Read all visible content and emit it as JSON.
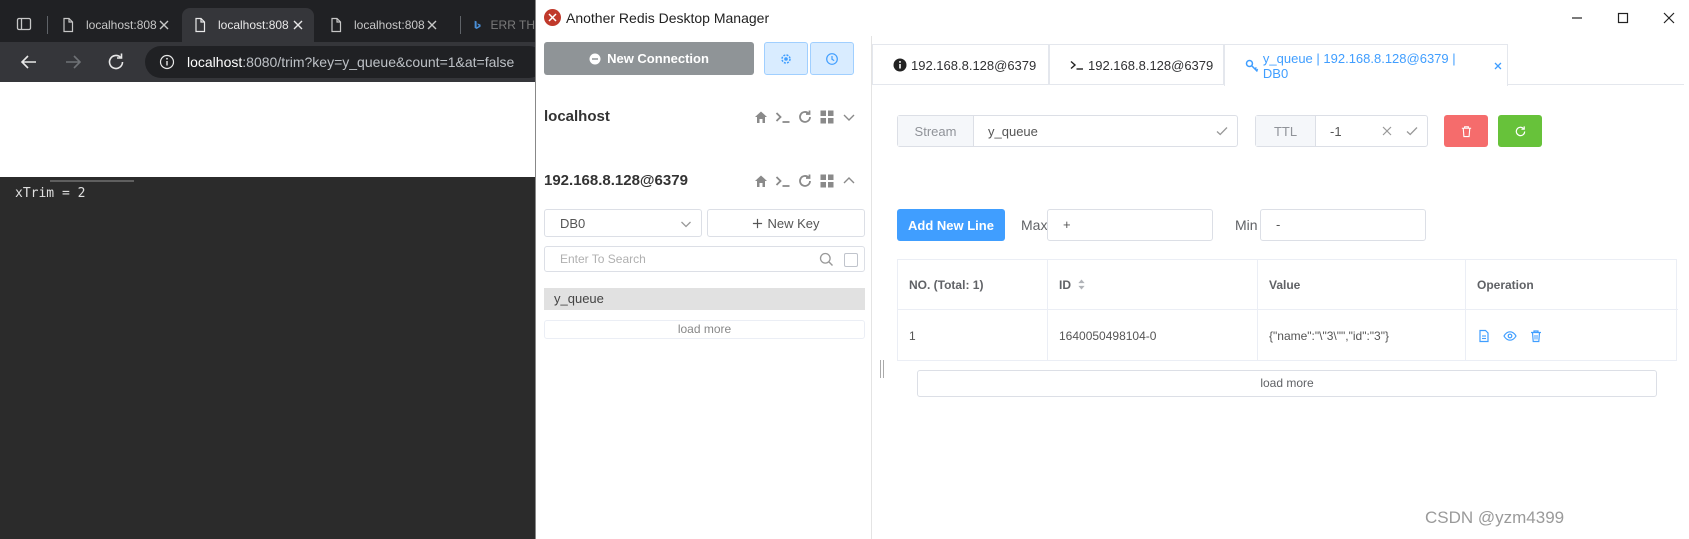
{
  "browser": {
    "tabs": [
      {
        "label": "localhost:808",
        "icon": "page-icon"
      },
      {
        "label": "localhost:808",
        "icon": "page-icon"
      },
      {
        "label": "localhost:808",
        "icon": "page-icon"
      },
      {
        "label": "ERR TH",
        "icon": "bing-icon"
      }
    ],
    "url_host": "localhost",
    "url_rest": ":8080/trim?key=y_queue&count=1&at=false",
    "page_output": "xTrim = 2"
  },
  "app": {
    "title": "Another Redis Desktop Manager",
    "new_connection_label": "New Connection",
    "connections": [
      {
        "name": "localhost"
      },
      {
        "name": "192.168.8.128@6379"
      }
    ],
    "db_select_value": "DB0",
    "new_key_label": "New Key",
    "search_placeholder": "Enter To Search",
    "keys": [
      "y_queue"
    ],
    "left_load_more": "load more",
    "tabs": [
      {
        "label": "192.168.8.128@6379",
        "icon": "info-icon"
      },
      {
        "label": "192.168.8.128@6379",
        "icon": "terminal-icon"
      },
      {
        "label": "y_queue | 192.168.8.128@6379 | DB0",
        "icon": "key-icon"
      }
    ],
    "key_type": "Stream",
    "key_name": "y_queue",
    "ttl_label": "TTL",
    "ttl_value": "-1",
    "add_new_line": "Add New Line",
    "max_label": "Max",
    "max_value": "+",
    "min_label": "Min",
    "min_value": "-",
    "table": {
      "headers": [
        "NO. (Total: 1)",
        "ID",
        "Value",
        "Operation"
      ],
      "rows": [
        {
          "no": "1",
          "id": "1640050498104-0",
          "value": "{\"name\":\"\\\"3\\\"\",\"id\":\"3\"}"
        }
      ]
    },
    "right_load_more": "load more"
  },
  "watermark": "CSDN @yzm4399",
  "colors": {
    "primary": "#409eff",
    "danger": "#f56c6c",
    "success": "#67c23a",
    "new_connection_bg": "#8f9497"
  }
}
